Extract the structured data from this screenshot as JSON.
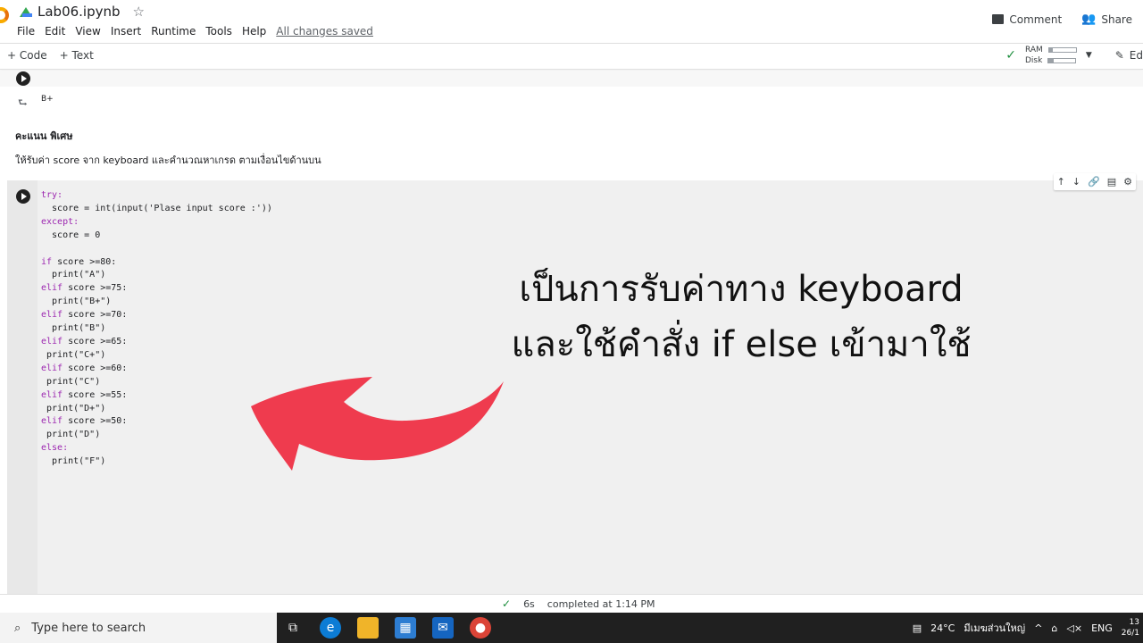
{
  "header": {
    "notebook_title": "Lab06.ipynb",
    "menu": [
      "File",
      "Edit",
      "View",
      "Insert",
      "Runtime",
      "Tools",
      "Help"
    ],
    "saved_status": "All changes saved",
    "comment_label": "Comment",
    "share_label": "Share"
  },
  "toolbar": {
    "add_code_label": "Code",
    "add_text_label": "Text",
    "ram_label": "RAM",
    "disk_label": "Disk",
    "ram_fraction": 0.15,
    "disk_fraction": 0.2,
    "edit_label": "Ed"
  },
  "notebook": {
    "prev_output": "B+",
    "markdown_heading": "คะแนน พิเศษ",
    "markdown_text": "ให้รับค่า score จาก keyboard และคำนวณหาเกรด ตามเงื่อนไขด้านบน",
    "code_lines": [
      "try:",
      "  score = int(input('Plase input score :'))",
      "except:",
      "  score = 0",
      "",
      "if score >=80:",
      "  print(\"A\")",
      "elif score >=75:",
      "  print(\"B+\")",
      "elif score >=70:",
      "  print(\"B\")",
      "elif score >=65:",
      " print(\"C+\")",
      "elif score >=60:",
      " print(\"C\")",
      "elif score >=55:",
      " print(\"D+\")",
      "elif score >=50:",
      " print(\"D\")",
      "else:",
      "  print(\"F\")"
    ]
  },
  "overlay": {
    "line1": "เป็นการรับค่าทาง keyboard",
    "line2": "และใช้คำสั่ง if else เข้ามาใช้",
    "arrow_color": "#ef3b4e"
  },
  "status": {
    "duration": "6s",
    "completed": "completed at 1:14 PM"
  },
  "taskbar": {
    "search_placeholder": "Type here to search",
    "weather": "24°C",
    "weather_text": "มีเมฆส่วนใหญ่",
    "language": "ENG",
    "clock_time": "13",
    "clock_date": "26/1"
  }
}
